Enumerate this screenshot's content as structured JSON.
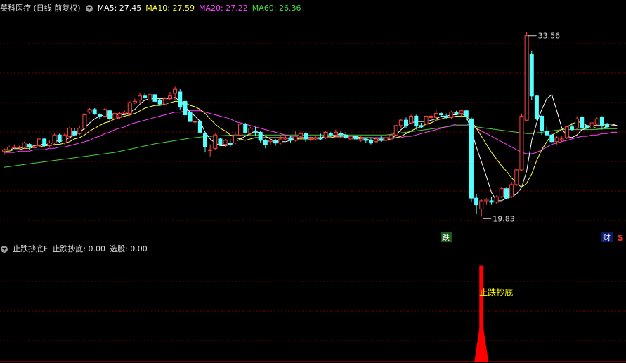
{
  "colors": {
    "background": "#000000",
    "up": "#ff4545",
    "down": "#54ffff",
    "ma5": "#ffffff",
    "ma10": "#ffff44",
    "ma20": "#ff44ff",
    "ma60": "#44cc44",
    "grid": "#7a0000",
    "signal": "#ff0000",
    "label": "#ffff00"
  },
  "main_header": {
    "title": "英科医疗 (日线 前复权)",
    "ma5": "MA5: 27.45",
    "ma10": "MA10: 27.59",
    "ma20": "MA20: 27.22",
    "ma60": "MA60: 26.36"
  },
  "sub_header": {
    "title": "止跌抄底F",
    "item1": "止跌抄底: 0.00",
    "item2": "选股: 0.00"
  },
  "chart_data": [
    {
      "type": "candlestick",
      "ylim": [
        18.8,
        34.8
      ],
      "annotations": {
        "high_label": "33.56",
        "low_label": "19.83",
        "mark_die": "跌",
        "mark_cai": "财",
        "mark_s": "S"
      },
      "candles": [
        [
          24.7,
          24.8,
          24.4,
          24.9
        ],
        [
          24.8,
          25.0,
          24.7,
          25.1
        ],
        [
          25.0,
          25.0,
          24.9,
          25.2
        ],
        [
          25.0,
          25.0,
          24.9,
          25.1
        ],
        [
          25.0,
          25.3,
          24.9,
          25.4
        ],
        [
          25.2,
          25.0,
          24.8,
          25.3
        ],
        [
          25.0,
          25.0,
          24.9,
          25.2
        ],
        [
          25.1,
          25.6,
          25.0,
          25.7
        ],
        [
          25.6,
          25.1,
          25.0,
          25.7
        ],
        [
          25.1,
          25.3,
          25.0,
          25.5
        ],
        [
          25.3,
          25.9,
          25.2,
          26.0
        ],
        [
          25.9,
          25.4,
          25.3,
          26.0
        ],
        [
          25.3,
          25.9,
          25.2,
          26.0
        ],
        [
          25.8,
          26.4,
          25.7,
          26.5
        ],
        [
          26.2,
          25.9,
          25.8,
          26.4
        ],
        [
          26.0,
          26.4,
          25.9,
          26.6
        ],
        [
          26.4,
          27.4,
          26.3,
          27.5
        ],
        [
          27.6,
          27.8,
          27.5,
          27.9
        ],
        [
          27.8,
          27.5,
          27.4,
          27.9
        ],
        [
          27.4,
          27.3,
          27.1,
          27.5
        ],
        [
          27.3,
          27.8,
          27.2,
          27.9
        ],
        [
          27.7,
          27.1,
          26.9,
          27.8
        ],
        [
          27.1,
          27.5,
          27.0,
          27.6
        ],
        [
          27.2,
          27.5,
          27.1,
          27.6
        ],
        [
          27.5,
          27.6,
          27.4,
          27.7
        ],
        [
          27.5,
          28.3,
          27.3,
          28.4
        ],
        [
          28.3,
          28.4,
          28.2,
          28.6
        ],
        [
          28.5,
          28.8,
          28.3,
          29.0
        ],
        [
          28.8,
          28.7,
          28.6,
          29.0
        ],
        [
          28.5,
          28.9,
          28.3,
          29.0
        ],
        [
          28.9,
          28.4,
          28.2,
          29.0
        ],
        [
          28.5,
          28.2,
          28.1,
          28.6
        ],
        [
          28.2,
          28.6,
          28.1,
          28.7
        ],
        [
          28.6,
          28.8,
          28.5,
          29.1
        ],
        [
          29.0,
          29.3,
          28.5,
          29.5
        ],
        [
          29.1,
          28.0,
          27.8,
          29.3
        ],
        [
          28.4,
          27.4,
          27.1,
          28.6
        ],
        [
          27.6,
          26.9,
          26.8,
          27.7
        ],
        [
          26.9,
          26.9,
          26.6,
          27.1
        ],
        [
          26.9,
          26.1,
          26.0,
          27.0
        ],
        [
          26.0,
          25.0,
          24.6,
          26.1
        ],
        [
          24.8,
          24.8,
          24.3,
          25.2
        ],
        [
          24.9,
          25.9,
          24.8,
          26.0
        ],
        [
          25.6,
          25.2,
          25.1,
          25.7
        ],
        [
          25.2,
          25.5,
          25.0,
          25.6
        ],
        [
          25.3,
          25.2,
          25.0,
          25.6
        ],
        [
          25.3,
          25.9,
          25.2,
          26.1
        ],
        [
          25.9,
          26.7,
          25.8,
          26.8
        ],
        [
          26.7,
          26.1,
          26.0,
          26.8
        ],
        [
          26.0,
          26.4,
          25.9,
          26.5
        ],
        [
          26.2,
          26.1,
          25.8,
          26.5
        ],
        [
          26.1,
          25.5,
          25.3,
          26.2
        ],
        [
          25.5,
          25.2,
          24.9,
          25.6
        ],
        [
          25.4,
          25.5,
          25.2,
          25.6
        ],
        [
          25.5,
          25.3,
          25.1,
          25.6
        ],
        [
          25.3,
          25.6,
          25.2,
          25.9
        ],
        [
          25.6,
          25.7,
          25.5,
          25.9
        ],
        [
          25.7,
          25.5,
          25.3,
          25.8
        ],
        [
          25.5,
          25.8,
          25.4,
          26.2
        ],
        [
          25.8,
          26.0,
          25.6,
          26.1
        ],
        [
          26.0,
          25.6,
          25.4,
          26.1
        ],
        [
          25.6,
          25.6,
          25.4,
          25.8
        ],
        [
          25.6,
          25.7,
          25.5,
          25.8
        ],
        [
          25.7,
          25.6,
          25.5,
          26.0
        ],
        [
          25.7,
          26.1,
          25.6,
          26.2
        ],
        [
          26.0,
          25.9,
          25.8,
          26.1
        ],
        [
          25.9,
          26.1,
          25.8,
          26.3
        ],
        [
          26.0,
          25.9,
          25.7,
          26.2
        ],
        [
          25.9,
          25.7,
          25.6,
          26.1
        ],
        [
          25.6,
          25.8,
          25.5,
          26.0
        ],
        [
          25.8,
          25.6,
          25.4,
          25.9
        ],
        [
          25.5,
          25.6,
          25.4,
          25.8
        ],
        [
          25.6,
          25.5,
          25.3,
          25.7
        ],
        [
          25.5,
          25.3,
          25.2,
          25.7
        ],
        [
          25.4,
          25.6,
          25.3,
          25.7
        ],
        [
          25.6,
          25.5,
          25.4,
          25.8
        ],
        [
          25.5,
          25.7,
          25.4,
          25.8
        ],
        [
          25.6,
          25.9,
          25.5,
          26.0
        ],
        [
          25.9,
          26.6,
          25.8,
          26.7
        ],
        [
          26.6,
          27.0,
          26.4,
          27.1
        ],
        [
          27.0,
          26.6,
          26.4,
          27.2
        ],
        [
          26.8,
          27.3,
          26.7,
          27.4
        ],
        [
          27.3,
          26.6,
          26.3,
          27.4
        ],
        [
          26.6,
          26.5,
          26.4,
          26.8
        ],
        [
          26.7,
          27.3,
          26.6,
          27.4
        ],
        [
          27.2,
          27.3,
          27.1,
          27.4
        ],
        [
          27.2,
          27.5,
          27.1,
          27.8
        ],
        [
          27.5,
          27.4,
          27.3,
          27.6
        ],
        [
          27.3,
          27.2,
          27.1,
          27.5
        ],
        [
          27.2,
          27.6,
          27.1,
          27.7
        ],
        [
          27.6,
          27.5,
          27.4,
          27.7
        ],
        [
          27.5,
          27.7,
          27.3,
          27.8
        ],
        [
          27.7,
          27.3,
          27.0,
          27.8
        ],
        [
          27.1,
          21.2,
          20.9,
          27.2
        ],
        [
          21.2,
          20.7,
          20.0,
          21.5
        ],
        [
          20.4,
          21.0,
          19.83,
          21.1
        ],
        [
          21.0,
          21.1,
          20.7,
          21.2
        ],
        [
          21.0,
          20.9,
          20.7,
          21.3
        ],
        [
          20.9,
          21.3,
          20.8,
          21.4
        ],
        [
          21.3,
          21.9,
          21.2,
          22.0
        ],
        [
          21.9,
          21.2,
          21.1,
          22.0
        ],
        [
          21.3,
          22.2,
          21.2,
          22.4
        ],
        [
          22.2,
          23.3,
          22.1,
          23.4
        ],
        [
          23.3,
          27.3,
          23.2,
          27.5
        ],
        [
          27.0,
          33.3,
          26.9,
          33.56
        ],
        [
          31.9,
          28.8,
          28.5,
          32.2
        ],
        [
          28.8,
          27.1,
          27.0,
          28.9
        ],
        [
          27.3,
          26.2,
          25.9,
          27.4
        ],
        [
          26.2,
          25.9,
          25.8,
          26.5
        ],
        [
          25.9,
          25.4,
          25.3,
          26.1
        ],
        [
          25.4,
          25.7,
          25.2,
          25.8
        ],
        [
          25.5,
          25.6,
          25.4,
          25.8
        ],
        [
          25.7,
          26.5,
          25.6,
          26.6
        ],
        [
          26.5,
          26.3,
          26.2,
          26.8
        ],
        [
          26.4,
          27.1,
          26.3,
          27.3
        ],
        [
          27.2,
          26.4,
          26.2,
          27.3
        ],
        [
          26.6,
          26.4,
          26.3,
          26.7
        ],
        [
          26.4,
          26.8,
          26.3,
          27.0
        ],
        [
          26.7,
          27.1,
          26.6,
          27.2
        ],
        [
          27.2,
          26.6,
          26.3,
          27.3
        ],
        [
          26.7,
          26.5,
          26.4,
          26.8
        ]
      ],
      "ma5": [
        24.8,
        24.8,
        24.9,
        24.9,
        25.0,
        25.0,
        25.1,
        25.2,
        25.2,
        25.2,
        25.4,
        25.5,
        25.5,
        25.7,
        25.9,
        26.1,
        26.4,
        26.8,
        27.1,
        27.3,
        27.4,
        27.4,
        27.4,
        27.4,
        27.4,
        27.6,
        27.8,
        28.2,
        28.5,
        28.6,
        28.6,
        28.6,
        28.6,
        28.6,
        28.7,
        28.4,
        28.0,
        27.6,
        27.3,
        26.9,
        26.1,
        25.6,
        25.3,
        25.1,
        25.1,
        25.2,
        25.4,
        25.6,
        25.8,
        26.0,
        26.2,
        26.0,
        25.8,
        25.6,
        25.4,
        25.4,
        25.4,
        25.5,
        25.6,
        25.7,
        25.7,
        25.7,
        25.7,
        25.7,
        25.8,
        25.8,
        25.9,
        26.0,
        25.9,
        25.8,
        25.7,
        25.6,
        25.6,
        25.5,
        25.5,
        25.5,
        25.5,
        25.6,
        25.9,
        26.3,
        26.6,
        26.8,
        26.9,
        26.9,
        26.9,
        27.0,
        27.1,
        27.3,
        27.3,
        27.4,
        27.4,
        27.5,
        27.3,
        26.2,
        25.0,
        23.9,
        22.8,
        21.6,
        21.0,
        21.0,
        21.2,
        21.3,
        21.5,
        22.0,
        23.2,
        25.5,
        26.8,
        27.8,
        28.6,
        28.9,
        27.7,
        26.4,
        25.8,
        25.7,
        25.9,
        26.3,
        26.4,
        26.6,
        26.6,
        26.6,
        26.7,
        26.7,
        26.6
      ],
      "ma10": [
        24.7,
        24.7,
        24.8,
        24.8,
        24.9,
        24.9,
        25.0,
        25.0,
        25.1,
        25.1,
        25.2,
        25.2,
        25.3,
        25.4,
        25.6,
        25.7,
        25.9,
        26.2,
        26.4,
        26.6,
        26.8,
        26.9,
        27.1,
        27.2,
        27.3,
        27.4,
        27.5,
        27.7,
        27.9,
        28.0,
        28.1,
        28.1,
        28.2,
        28.3,
        28.4,
        28.4,
        28.3,
        28.1,
        28.0,
        27.8,
        27.5,
        27.1,
        26.7,
        26.4,
        26.2,
        25.9,
        25.7,
        25.6,
        25.5,
        25.6,
        25.7,
        25.7,
        25.7,
        25.7,
        25.7,
        25.7,
        25.7,
        25.6,
        25.6,
        25.6,
        25.6,
        25.6,
        25.6,
        25.7,
        25.7,
        25.7,
        25.8,
        25.8,
        25.8,
        25.8,
        25.8,
        25.7,
        25.7,
        25.7,
        25.6,
        25.6,
        25.6,
        25.6,
        25.7,
        25.8,
        26.0,
        26.2,
        26.4,
        26.5,
        26.7,
        26.8,
        27.0,
        27.1,
        27.2,
        27.2,
        27.3,
        27.3,
        27.3,
        26.9,
        26.4,
        25.8,
        25.2,
        24.6,
        24.1,
        23.6,
        23.2,
        22.7,
        22.3,
        22.0,
        22.3,
        23.0,
        24.0,
        24.8,
        25.4,
        25.9,
        26.1,
        26.3,
        26.5,
        26.7,
        26.9,
        26.8,
        26.6,
        26.5,
        26.4,
        26.4,
        26.5,
        26.6,
        26.6
      ],
      "ma20": [
        24.6,
        24.6,
        24.6,
        24.7,
        24.7,
        24.7,
        24.8,
        24.8,
        24.8,
        24.9,
        24.9,
        25.0,
        25.0,
        25.1,
        25.2,
        25.3,
        25.4,
        25.5,
        25.7,
        25.8,
        26.0,
        26.1,
        26.3,
        26.4,
        26.5,
        26.7,
        26.8,
        26.9,
        27.0,
        27.1,
        27.2,
        27.3,
        27.4,
        27.5,
        27.6,
        27.6,
        27.7,
        27.7,
        27.7,
        27.7,
        27.6,
        27.5,
        27.4,
        27.3,
        27.2,
        27.1,
        26.9,
        26.8,
        26.7,
        26.6,
        26.5,
        26.4,
        26.3,
        26.2,
        26.1,
        26.0,
        25.9,
        25.8,
        25.7,
        25.7,
        25.7,
        25.7,
        25.7,
        25.7,
        25.7,
        25.7,
        25.7,
        25.7,
        25.7,
        25.7,
        25.7,
        25.7,
        25.7,
        25.7,
        25.7,
        25.7,
        25.7,
        25.7,
        25.7,
        25.7,
        25.8,
        25.8,
        25.9,
        26.0,
        26.1,
        26.2,
        26.3,
        26.4,
        26.5,
        26.6,
        26.7,
        26.7,
        26.7,
        26.6,
        26.4,
        26.2,
        26.0,
        25.8,
        25.6,
        25.4,
        25.2,
        25.0,
        24.8,
        24.6,
        24.5,
        24.5,
        24.6,
        24.8,
        25.0,
        25.2,
        25.3,
        25.4,
        25.5,
        25.6,
        25.7,
        25.8,
        25.8,
        25.9,
        25.9,
        26.0,
        26.0,
        26.1,
        26.1
      ],
      "ma60": [
        23.5,
        23.55,
        23.6,
        23.65,
        23.7,
        23.75,
        23.8,
        23.85,
        23.9,
        23.95,
        24.0,
        24.05,
        24.1,
        24.15,
        24.2,
        24.25,
        24.3,
        24.35,
        24.4,
        24.45,
        24.5,
        24.55,
        24.6,
        24.68,
        24.76,
        24.84,
        24.92,
        25.0,
        25.08,
        25.16,
        25.24,
        25.3,
        25.36,
        25.42,
        25.48,
        25.54,
        25.6,
        25.66,
        25.7,
        25.74,
        25.78,
        25.8,
        25.82,
        25.84,
        25.86,
        25.88,
        25.9,
        25.9,
        25.9,
        25.9,
        25.9,
        25.9,
        25.9,
        25.9,
        25.9,
        25.9,
        25.9,
        25.9,
        25.9,
        25.9,
        25.9,
        25.9,
        25.9,
        25.9,
        25.9,
        25.9,
        25.9,
        25.9,
        25.9,
        25.9,
        25.9,
        25.9,
        25.9,
        25.9,
        25.9,
        25.9,
        25.9,
        25.95,
        26.0,
        26.05,
        26.1,
        26.15,
        26.2,
        26.25,
        26.3,
        26.35,
        26.4,
        26.45,
        26.5,
        26.55,
        26.6,
        26.6,
        26.6,
        26.55,
        26.5,
        26.45,
        26.4,
        26.35,
        26.3,
        26.25,
        26.2,
        26.15,
        26.1,
        26.05,
        26.0,
        26.0,
        26.05,
        26.1,
        26.15,
        26.2,
        26.25,
        26.3,
        26.3,
        26.3,
        26.3,
        26.3,
        26.3,
        26.3,
        26.32,
        26.34,
        26.36,
        26.36,
        26.36
      ]
    },
    {
      "type": "area",
      "signal_label": "止跌抄底",
      "signal_index": 95,
      "signal_value": 1,
      "ylim": [
        0,
        1.1
      ]
    }
  ]
}
